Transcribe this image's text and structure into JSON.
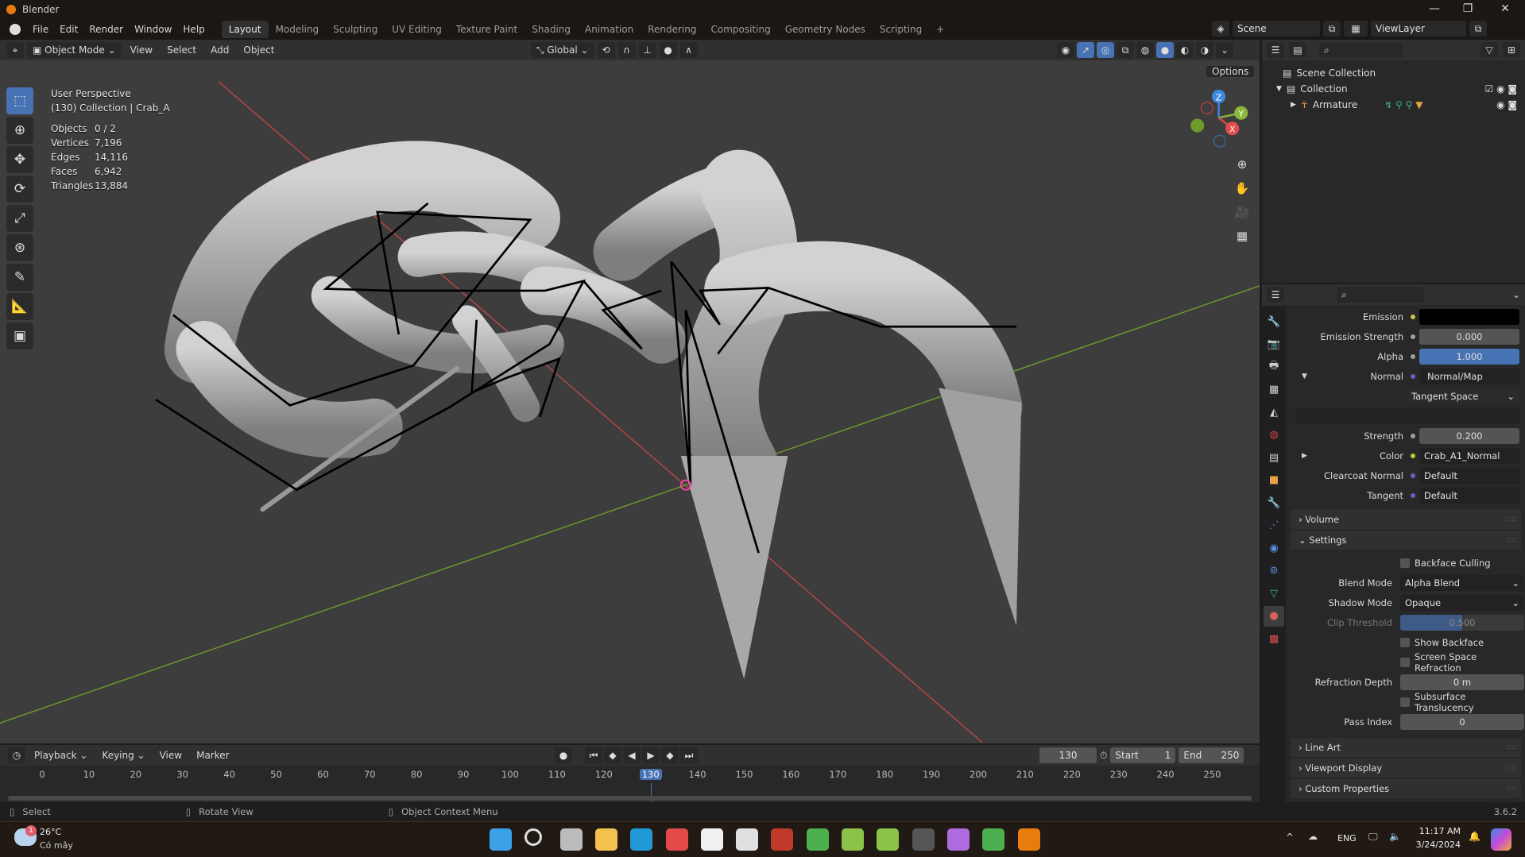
{
  "window": {
    "title": "Blender",
    "minimize": "—",
    "maximize": "❐",
    "close": "✕"
  },
  "menu": [
    "File",
    "Edit",
    "Render",
    "Window",
    "Help"
  ],
  "workspaces": [
    "Layout",
    "Modeling",
    "Sculpting",
    "UV Editing",
    "Texture Paint",
    "Shading",
    "Animation",
    "Rendering",
    "Compositing",
    "Geometry Nodes",
    "Scripting",
    "+"
  ],
  "scene": {
    "scene_name": "Scene",
    "view_layer": "ViewLayer"
  },
  "viewport_header": {
    "mode": "Object Mode",
    "menus": [
      "View",
      "Select",
      "Add",
      "Object"
    ],
    "orientation": "Global",
    "options": "Options"
  },
  "overlay": {
    "view_name": "User Perspective",
    "collection": "(130) Collection | Crab_A",
    "stats": [
      {
        "label": "Objects",
        "value": "0 / 2"
      },
      {
        "label": "Vertices",
        "value": "7,196"
      },
      {
        "label": "Edges",
        "value": "14,116"
      },
      {
        "label": "Faces",
        "value": "6,942"
      },
      {
        "label": "Triangles",
        "value": "13,884"
      }
    ]
  },
  "gizmo": {
    "x": "X",
    "y": "Y",
    "z": "Z"
  },
  "outliner": {
    "root": "Scene Collection",
    "collection": "Collection",
    "object": "Armature"
  },
  "properties": {
    "rows": [
      {
        "label": "Emission",
        "value": "",
        "dot": "#c8c83a"
      },
      {
        "label": "Emission Strength",
        "value": "0.000",
        "dot": "#a0a0a0"
      },
      {
        "label": "Alpha",
        "value": "1.000",
        "dot": "#a0a0a0"
      },
      {
        "label": "Normal",
        "value": "Normal/Map",
        "dot": "#6363c7"
      },
      {
        "label": "",
        "value": "Tangent Space"
      },
      {
        "label": "",
        "value": ""
      },
      {
        "label": "Strength",
        "value": "0.200",
        "dot": "#a0a0a0"
      },
      {
        "label": "Color",
        "value": "Crab_A1_Normal",
        "dot": "#c8c83a"
      },
      {
        "label": "Clearcoat Normal",
        "value": "Default",
        "dot": "#6363c7"
      },
      {
        "label": "Tangent",
        "value": "Default",
        "dot": "#6363c7"
      }
    ],
    "panels": {
      "volume": "Volume",
      "settings": "Settings",
      "line_art": "Line Art",
      "viewport_display": "Viewport Display",
      "custom_properties": "Custom Properties"
    },
    "settings": {
      "backface_culling": "Backface Culling",
      "blend_mode_label": "Blend Mode",
      "blend_mode": "Alpha Blend",
      "shadow_mode_label": "Shadow Mode",
      "shadow_mode": "Opaque",
      "clip_threshold_label": "Clip Threshold",
      "clip_threshold": "0.500",
      "show_backface": "Show Backface",
      "ssr": "Screen Space Refraction",
      "refraction_depth_label": "Refraction Depth",
      "refraction_depth": "0 m",
      "subsurface": "Subsurface Translucency",
      "pass_index_label": "Pass Index",
      "pass_index": "0"
    }
  },
  "timeline": {
    "menus": [
      "Playback",
      "Keying",
      "View",
      "Marker"
    ],
    "current_frame": "130",
    "start_label": "Start",
    "start": "1",
    "end_label": "End",
    "end": "250",
    "ticks": [
      "0",
      "10",
      "20",
      "30",
      "40",
      "50",
      "60",
      "70",
      "80",
      "90",
      "100",
      "110",
      "120",
      "130",
      "140",
      "150",
      "160",
      "170",
      "180",
      "190",
      "200",
      "210",
      "220",
      "230",
      "240",
      "250"
    ]
  },
  "statusbar": {
    "select": "Select",
    "rotate": "Rotate View",
    "context": "Object Context Menu",
    "version": "3.6.2"
  },
  "taskbar": {
    "weather_temp": "26°C",
    "weather_text": "Có mây",
    "weather_badge": "1",
    "lang": "ENG",
    "time": "11:17 AM",
    "date": "3/24/2024",
    "apps": [
      {
        "name": "start",
        "color": "#3aa0e8"
      },
      {
        "name": "search",
        "color": "#ddd"
      },
      {
        "name": "task-view",
        "color": "#bbb"
      },
      {
        "name": "file-explorer",
        "color": "#f2c14e"
      },
      {
        "name": "edge",
        "color": "#1f9ad6"
      },
      {
        "name": "snipping-tool",
        "color": "#e24a4a"
      },
      {
        "name": "store",
        "color": "#f0f0f0"
      },
      {
        "name": "app",
        "color": "#e0e0e0"
      },
      {
        "name": "app-m",
        "color": "#c0392b"
      },
      {
        "name": "chrome",
        "color": "#4caf50"
      },
      {
        "name": "app-green",
        "color": "#8bc34a"
      },
      {
        "name": "app-green-2",
        "color": "#8bc34a"
      },
      {
        "name": "terminal",
        "color": "#555"
      },
      {
        "name": "affinity",
        "color": "#b06ae0"
      },
      {
        "name": "chrome-2",
        "color": "#4caf50"
      },
      {
        "name": "blender",
        "color": "#e87d0d"
      }
    ]
  }
}
